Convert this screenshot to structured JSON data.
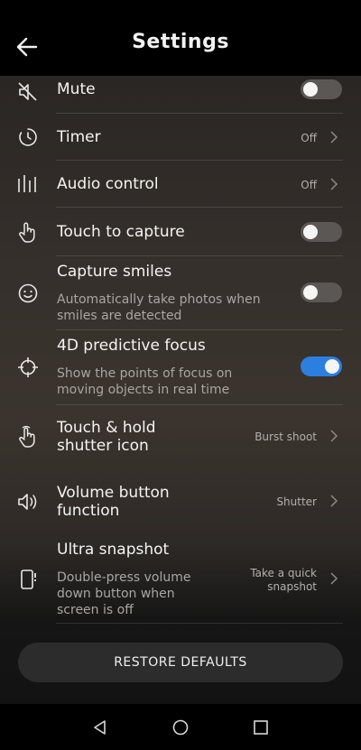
{
  "header": {
    "title": "Settings"
  },
  "rows": {
    "mute": {
      "label": "Mute",
      "toggle_on": false
    },
    "timer": {
      "label": "Timer",
      "value": "Off"
    },
    "audio": {
      "label": "Audio control",
      "value": "Off"
    },
    "touch": {
      "label": "Touch to capture",
      "toggle_on": false
    },
    "smiles": {
      "label": "Capture smiles",
      "description": "Automatically take photos when smiles are detected",
      "toggle_on": false
    },
    "focus": {
      "label": "4D predictive focus",
      "description": "Show the points of focus on moving objects in real time",
      "toggle_on": true
    },
    "hold": {
      "label_line1": "Touch & hold",
      "label_line2": "shutter icon",
      "value": "Burst shoot"
    },
    "volume": {
      "label_line1": "Volume button",
      "label_line2": "function",
      "value": "Shutter"
    },
    "ultra": {
      "label": "Ultra snapshot",
      "desc_line1": "Double-press volume",
      "desc_line2": "down button when",
      "desc_line3": "screen is off",
      "value_line1": "Take a quick",
      "value_line2": "snapshot"
    }
  },
  "restore_label": "RESTORE DEFAULTS",
  "icons": [
    "back-arrow-icon",
    "mute-icon",
    "timer-icon",
    "audio-bars-icon",
    "touch-hand-icon",
    "smile-icon",
    "focus-target-icon",
    "hold-hand-icon",
    "speaker-icon",
    "phone-volume-icon",
    "nav-back-icon",
    "nav-home-icon",
    "nav-recent-icon"
  ],
  "colors": {
    "accent": "#2b7fe0",
    "toggle_off": "#5a5754"
  }
}
